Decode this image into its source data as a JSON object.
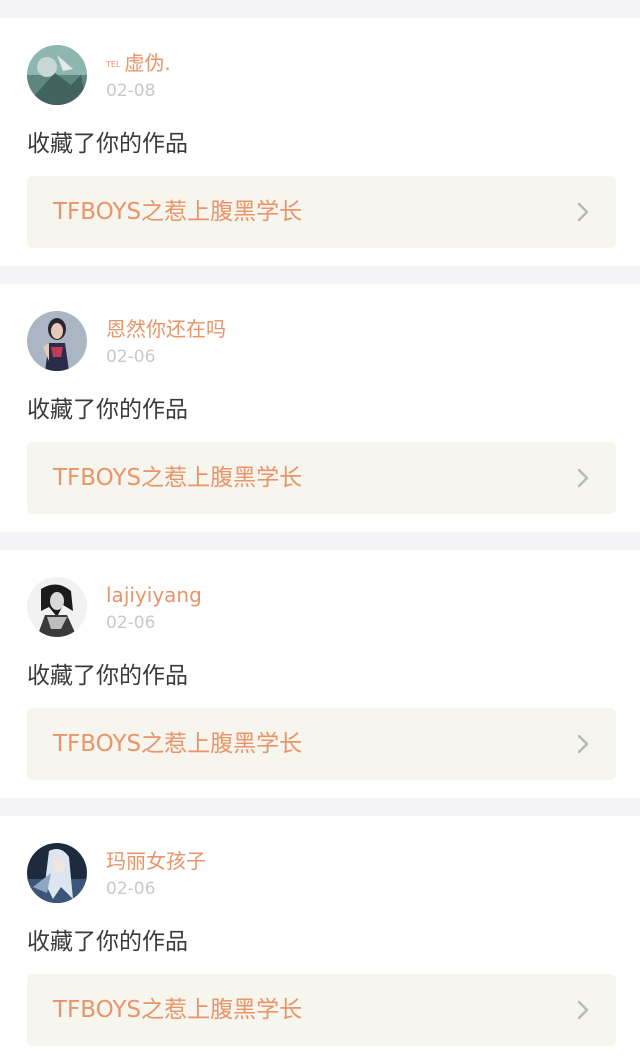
{
  "colors": {
    "accent": "#e9956a",
    "background": "#f4f3f5",
    "card": "#ffffff",
    "link_box": "#f6f5ee",
    "date": "#c9c9c9",
    "body_text": "#3a3a3a"
  },
  "notifications": [
    {
      "username_prefix": "TEL",
      "username": "虚伪.",
      "date": "02-08",
      "action": "收藏了你的作品",
      "work_title": "TFBOYS之惹上腹黑学长",
      "avatar_icon": "avatar-icon"
    },
    {
      "username": "恩然你还在吗",
      "date": "02-06",
      "action": "收藏了你的作品",
      "work_title": "TFBOYS之惹上腹黑学长",
      "avatar_icon": "avatar-icon"
    },
    {
      "username": "lajiyiyang",
      "date": "02-06",
      "action": "收藏了你的作品",
      "work_title": "TFBOYS之惹上腹黑学长",
      "avatar_icon": "avatar-icon"
    },
    {
      "username": "玛丽女孩子",
      "date": "02-06",
      "action": "收藏了你的作品",
      "work_title": "TFBOYS之惹上腹黑学长",
      "avatar_icon": "avatar-icon"
    }
  ]
}
